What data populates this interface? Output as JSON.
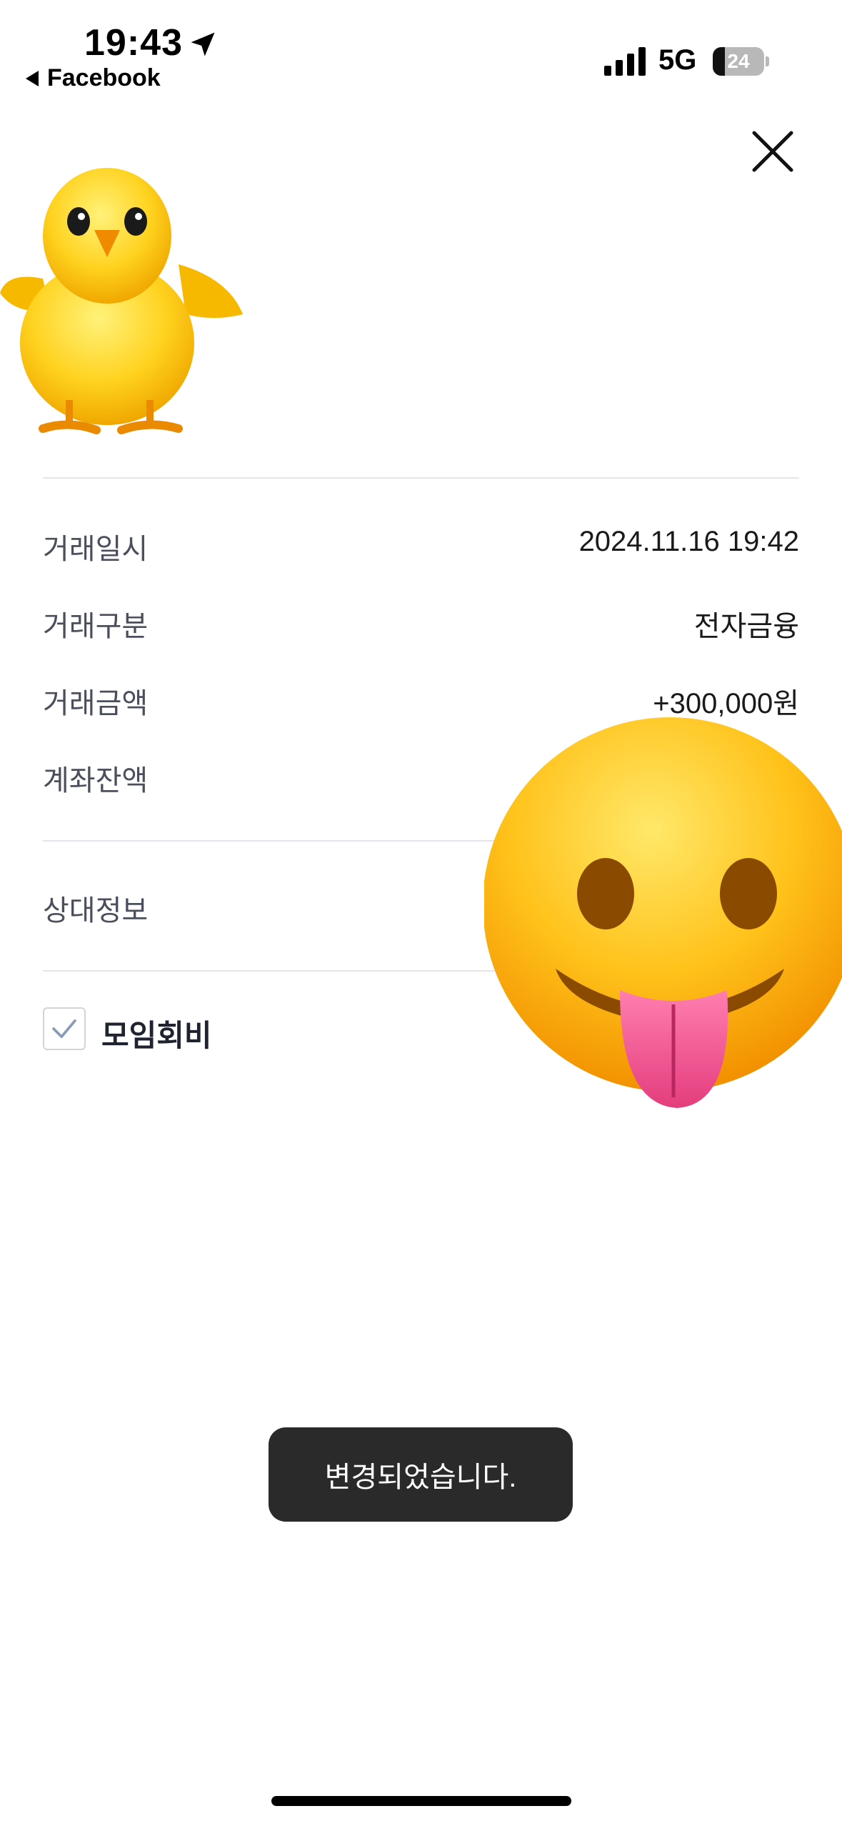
{
  "status_bar": {
    "time": "19:43",
    "back_app": "Facebook",
    "network": "5G",
    "battery_percent": "24",
    "battery_level": 0.24,
    "signal_bars": 4
  },
  "details": {
    "rows": [
      {
        "label": "거래일시",
        "value": "2024.11.16 19:42"
      },
      {
        "label": "거래구분",
        "value": "전자금융"
      },
      {
        "label": "거래금액",
        "value": "+300,000원"
      },
      {
        "label": "계좌잔액",
        "value": ""
      }
    ],
    "counterparty_label": "상대정보",
    "memo": {
      "label": "모임회비",
      "checked": true
    }
  },
  "toast": {
    "message": "변경되었습니다."
  },
  "icons": {
    "close": "close-icon",
    "check": "check-icon",
    "location": "location-arrow-icon",
    "stickers": [
      "chick-sticker",
      "tongue-face-sticker"
    ]
  },
  "colors": {
    "toast_bg": "#2a2a2a",
    "label_text": "#4b4f5c",
    "divider": "#e3e4ec",
    "chick_yellow": "#ffd21f"
  }
}
